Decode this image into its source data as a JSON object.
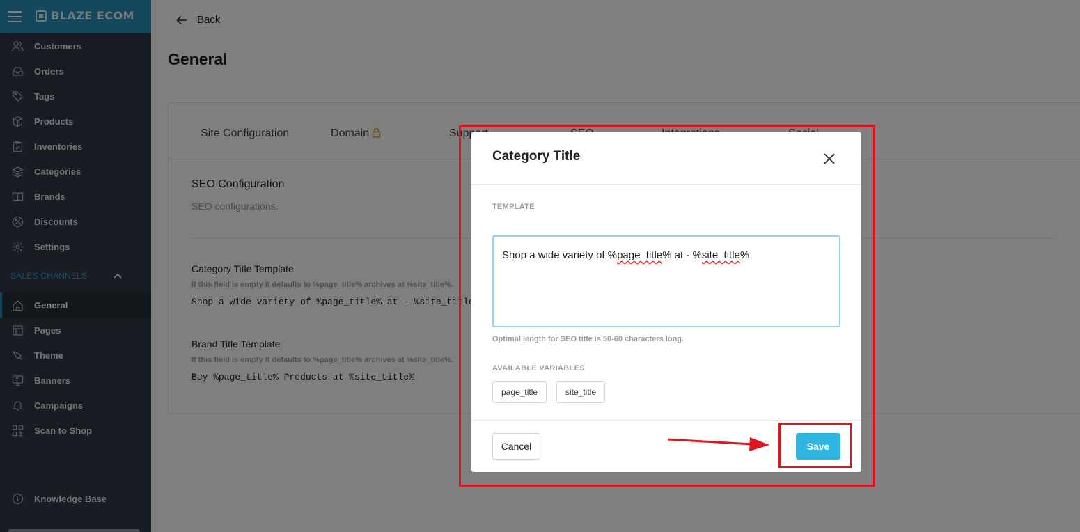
{
  "brand": {
    "name": "BLAZE ECOM"
  },
  "sidebar": {
    "items": [
      {
        "label": "Customers",
        "icon": "users-icon"
      },
      {
        "label": "Orders",
        "icon": "inbox-icon"
      },
      {
        "label": "Tags",
        "icon": "tag-icon"
      },
      {
        "label": "Products",
        "icon": "box-icon"
      },
      {
        "label": "Inventories",
        "icon": "clipboard-icon"
      },
      {
        "label": "Categories",
        "icon": "layers-icon"
      },
      {
        "label": "Brands",
        "icon": "book-icon"
      },
      {
        "label": "Discounts",
        "icon": "percent-icon"
      },
      {
        "label": "Settings",
        "icon": "gear-icon"
      }
    ],
    "sales_channels_label": "SALES CHANNELS",
    "channel_items": [
      {
        "label": "General",
        "icon": "home-icon",
        "active": true
      },
      {
        "label": "Pages",
        "icon": "pages-icon"
      },
      {
        "label": "Theme",
        "icon": "brush-icon"
      },
      {
        "label": "Banners",
        "icon": "monitor-icon"
      },
      {
        "label": "Campaigns",
        "icon": "bell-icon"
      },
      {
        "label": "Scan to Shop",
        "icon": "qr-icon"
      }
    ],
    "knowledge_base": "Knowledge Base"
  },
  "header": {
    "back_label": "Back",
    "title": "General"
  },
  "tabs": [
    "Site Configuration",
    "Domain",
    "Support",
    "SEO",
    "Integrations",
    "Social"
  ],
  "seo": {
    "title": "SEO Configuration",
    "subtitle": "SEO configurations.",
    "category": {
      "label": "Category Title Template",
      "hint": "If this field is empty it defaults to %page_title% archives at %site_title%.",
      "value": "Shop a wide variety of %page_title% at - %site_title%"
    },
    "brand": {
      "label": "Brand Title Template",
      "hint": "If this field is empty it defaults to %page_title% archives at %site_title%.",
      "value": "Buy %page_title% Products at %site_title%"
    }
  },
  "modal": {
    "title": "Category Title",
    "template_label": "TEMPLATE",
    "template_parts": [
      "Shop a wide variety of %",
      "page_title",
      "% at - %",
      "site_title",
      "%"
    ],
    "hint": "Optimal length for SEO title is 50-60 characters long.",
    "variables_label": "AVAILABLE VARIABLES",
    "variables": [
      "page_title",
      "site_title"
    ],
    "cancel_label": "Cancel",
    "save_label": "Save"
  },
  "colors": {
    "sidebar_bg": "#2e3a46",
    "brand_bar": "#2892b8",
    "save_button": "#2db4e0",
    "annotation": "#e0141e"
  }
}
